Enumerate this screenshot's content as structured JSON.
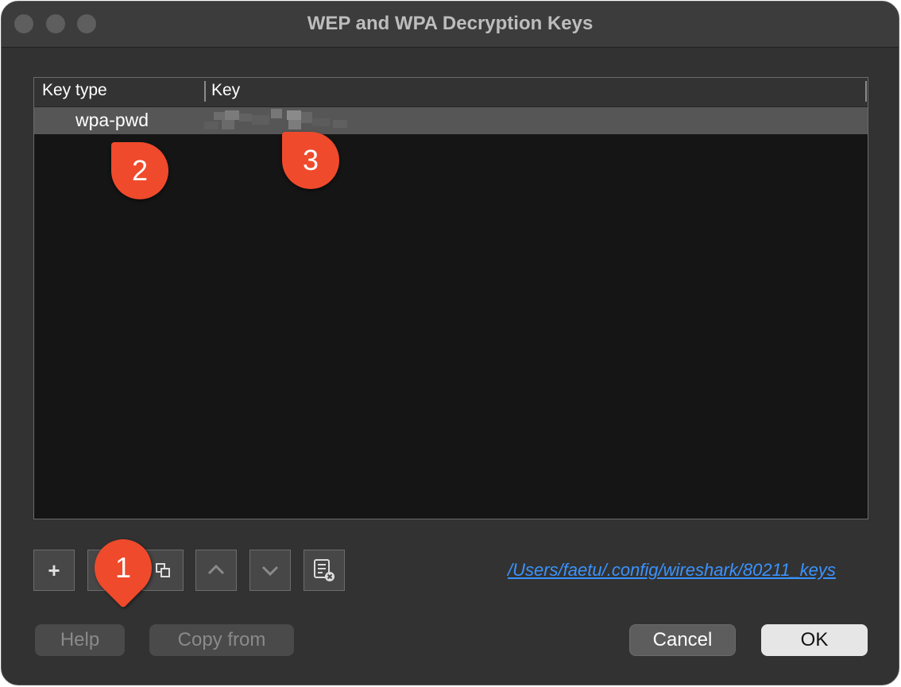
{
  "window": {
    "title": "WEP and WPA Decryption Keys"
  },
  "table": {
    "columns": [
      "Key type",
      "Key"
    ],
    "rows": [
      {
        "key_type": "wpa-pwd",
        "key": ""
      }
    ]
  },
  "annotations": [
    "1",
    "2",
    "3"
  ],
  "toolbar": {
    "add_label": "+",
    "icons": [
      "add-icon",
      "remove-icon",
      "copy-icon",
      "move-up-icon",
      "move-down-icon",
      "clear-icon"
    ]
  },
  "file_path": "/Users/faetu/.config/wireshark/80211_keys",
  "buttons": {
    "help": "Help",
    "copy_from": "Copy from",
    "cancel": "Cancel",
    "ok": "OK"
  },
  "colors": {
    "accent_badge": "#ef4a2c",
    "link": "#3a93ff",
    "selected_row": "#565656"
  }
}
